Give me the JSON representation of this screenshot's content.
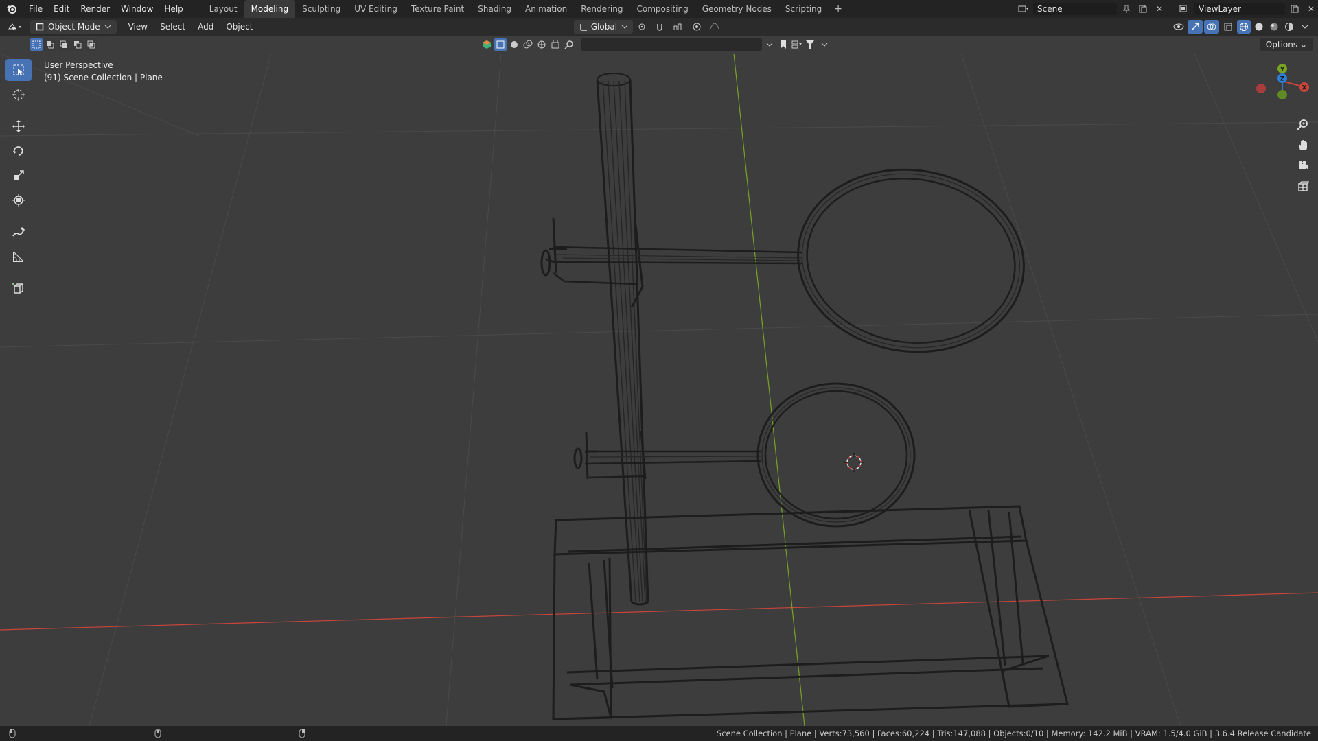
{
  "app": {
    "menu": [
      "File",
      "Edit",
      "Render",
      "Window",
      "Help"
    ],
    "workspace_tabs": [
      "Layout",
      "Modeling",
      "Sculpting",
      "UV Editing",
      "Texture Paint",
      "Shading",
      "Animation",
      "Rendering",
      "Compositing",
      "Geometry Nodes",
      "Scripting"
    ],
    "active_tab": "Modeling",
    "scene_name": "Scene",
    "view_layer": "ViewLayer"
  },
  "header": {
    "mode": "Object Mode",
    "menus": [
      "View",
      "Select",
      "Add",
      "Object"
    ],
    "orientation": "Global",
    "options_label": "Options"
  },
  "viewport": {
    "perspective": "User Perspective",
    "collection_info": "(91) Scene Collection | Plane"
  },
  "status": {
    "text": "Scene Collection | Plane | Verts:73,560 | Faces:60,224 | Tris:147,088 | Objects:0/10 | Memory: 142.2 MiB | VRAM: 1.5/4.0 GiB | 3.6.4 Release Candidate"
  },
  "colors": {
    "accent": "#4772b3",
    "x_axis": "#c8453c",
    "y_axis": "#79a323",
    "z_axis": "#2f7ed6"
  },
  "icons": {
    "tools": [
      "select-box-icon",
      "cursor-icon",
      "move-icon",
      "rotate-icon",
      "scale-icon",
      "transform-icon",
      "annotate-icon",
      "measure-icon",
      "add-cube-icon"
    ],
    "navigation": [
      "zoom-icon",
      "pan-hand-icon",
      "camera-icon",
      "grid-ortho-icon"
    ]
  }
}
